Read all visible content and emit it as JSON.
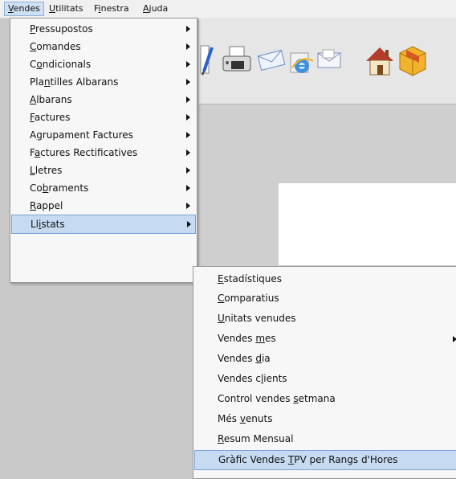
{
  "menubar": {
    "items": [
      {
        "pre": "",
        "u": "V",
        "post": "endes"
      },
      {
        "pre": "",
        "u": "U",
        "post": "tilitats"
      },
      {
        "pre": "F",
        "u": "i",
        "post": "nestra"
      },
      {
        "pre": "",
        "u": "A",
        "post": "juda"
      }
    ]
  },
  "vendes_menu": {
    "items": [
      {
        "pre": "",
        "u": "P",
        "post": "ressupostos"
      },
      {
        "pre": "",
        "u": "C",
        "post": "omandes"
      },
      {
        "pre": "C",
        "u": "o",
        "post": "ndicionals"
      },
      {
        "pre": "Pla",
        "u": "n",
        "post": "tilles Albarans"
      },
      {
        "pre": "",
        "u": "A",
        "post": "lbarans"
      },
      {
        "pre": "",
        "u": "F",
        "post": "actures"
      },
      {
        "pre": "A",
        "u": "g",
        "post": "rupament Factures"
      },
      {
        "pre": "F",
        "u": "a",
        "post": "ctures Rectificatives"
      },
      {
        "pre": "",
        "u": "L",
        "post": "letres"
      },
      {
        "pre": "Co",
        "u": "b",
        "post": "raments"
      },
      {
        "pre": "",
        "u": "R",
        "post": "appel"
      },
      {
        "pre": "Ll",
        "u": "i",
        "post": "stats"
      }
    ]
  },
  "llistats_submenu": {
    "items": [
      {
        "pre": "",
        "u": "E",
        "post": "stadístiques"
      },
      {
        "pre": "",
        "u": "C",
        "post": "omparatius"
      },
      {
        "pre": "",
        "u": "U",
        "post": "nitats venudes"
      },
      {
        "pre": "Vendes ",
        "u": "m",
        "post": "es"
      },
      {
        "pre": "Vendes ",
        "u": "d",
        "post": "ia"
      },
      {
        "pre": "Vendes c",
        "u": "l",
        "post": "ients"
      },
      {
        "pre": "Control vendes ",
        "u": "s",
        "post": "etmana"
      },
      {
        "pre": "Més ",
        "u": "v",
        "post": "enuts"
      },
      {
        "pre": "",
        "u": "R",
        "post": "esum Mensual"
      },
      {
        "pre": "Gràfic Vendes ",
        "u": "T",
        "post": "PV per Rangs d'Hores"
      }
    ]
  },
  "toolbar_icons": [
    "edit-icon",
    "fax-icon",
    "envelope-icon",
    "internet-explorer-icon",
    "mail-icon",
    "home-icon",
    "package-icon"
  ],
  "colors": {
    "highlight": "#c6dbf2",
    "highlight_border": "#7aa3d4",
    "menu_bg": "#f7f7f7"
  }
}
